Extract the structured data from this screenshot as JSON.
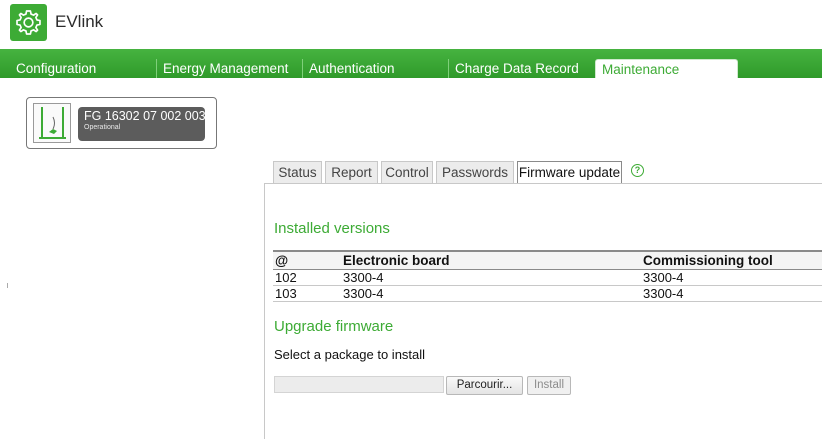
{
  "app": {
    "title": "EVlink"
  },
  "nav": {
    "tabs": [
      {
        "label": "Configuration"
      },
      {
        "label": "Energy Management"
      },
      {
        "label": "Authentication"
      },
      {
        "label": "Charge Data Record"
      },
      {
        "label": "Maintenance",
        "active": true
      }
    ]
  },
  "station": {
    "id": "FG 16302 07 002 003",
    "status": "Operational"
  },
  "subtabs": [
    {
      "label": "Status"
    },
    {
      "label": "Report"
    },
    {
      "label": "Control"
    },
    {
      "label": "Passwords"
    },
    {
      "label": "Firmware update",
      "active": true
    }
  ],
  "help_icon_glyph": "?",
  "installed": {
    "title": "Installed versions",
    "columns": [
      "@",
      "Electronic board",
      "Commissioning tool"
    ],
    "rows": [
      [
        "102",
        "3300-4",
        "3300-4"
      ],
      [
        "103",
        "3300-4",
        "3300-4"
      ]
    ]
  },
  "upgrade": {
    "title": "Upgrade firmware",
    "instruction": "Select a package to install",
    "file_value": "",
    "browse_label": "Parcourir...",
    "install_label": "Install",
    "install_disabled": true
  },
  "colors": {
    "brand": "#3dab35",
    "nav_dark": "#2f9a2a",
    "station_box": "#5c5c5c"
  },
  "icons": {
    "logo": "gear-icon",
    "station": "charging-station-icon",
    "help": "help-icon"
  }
}
